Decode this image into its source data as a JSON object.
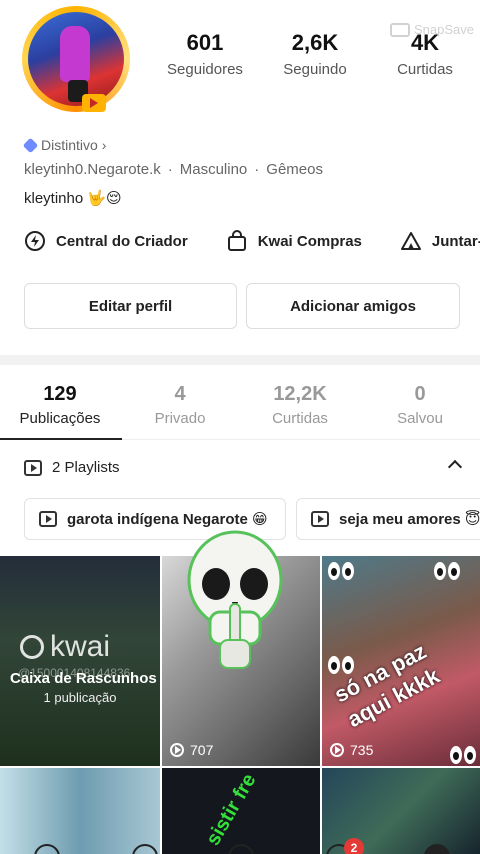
{
  "profile": {
    "stats": [
      {
        "value": "601",
        "label": "Seguidores"
      },
      {
        "value": "2,6K",
        "label": "Seguindo"
      },
      {
        "value": "4K",
        "label": "Curtidas"
      }
    ],
    "badge_label": "Distintivo",
    "username": "kleytinh0.Negarote.k",
    "gender": "Masculino",
    "sign": "Gêmeos",
    "bio": "kleytinho 🤟😌",
    "watermark": "SnapSave"
  },
  "quick_actions": [
    {
      "label": "Central do Criador",
      "icon": "creator-center-icon"
    },
    {
      "label": "Kwai Compras",
      "icon": "shopping-bag-icon"
    },
    {
      "label": "Juntar-s",
      "icon": "tent-icon"
    }
  ],
  "buttons": {
    "edit": "Editar perfil",
    "add": "Adicionar amigos"
  },
  "tabs": [
    {
      "value": "129",
      "label": "Publicações",
      "active": true
    },
    {
      "value": "4",
      "label": "Privado"
    },
    {
      "value": "12,2K",
      "label": "Curtidas"
    },
    {
      "value": "0",
      "label": "Salvou"
    }
  ],
  "playlists": {
    "header": "2 Playlists",
    "items": [
      "garota indígena Negarote 😁",
      "seja meu amores 😇"
    ]
  },
  "grid": {
    "draft": {
      "title": "Caixa de Rascunhos",
      "count": "1 publicação",
      "brand": "kwai",
      "id": "@150001408144836"
    },
    "videos": [
      {
        "views": "707"
      },
      {
        "views": "735",
        "caption": "só na paz aqui kkkk"
      },
      {
        "caption": "sistir fre"
      }
    ]
  },
  "nav": {
    "notification_count": "2"
  },
  "colors": {
    "accent_red": "#e53935",
    "text_dark": "#222222",
    "text_muted": "#999999",
    "badge_blue": "#6e8bff"
  }
}
